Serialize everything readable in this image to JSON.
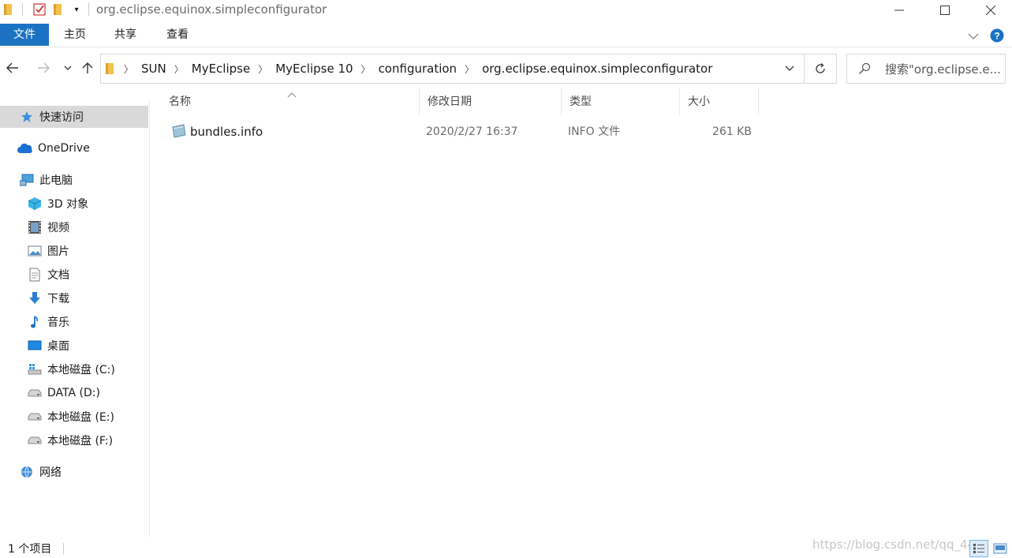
{
  "window": {
    "title": "org.eclipse.equinox.simpleconfigurator"
  },
  "ribbon": {
    "tabs": [
      {
        "label": "文件"
      },
      {
        "label": "主页"
      },
      {
        "label": "共享"
      },
      {
        "label": "查看"
      }
    ]
  },
  "address": {
    "crumbs": [
      "SUN",
      "MyEclipse",
      "MyEclipse 10",
      "configuration",
      "org.eclipse.equinox.simpleconfigurator"
    ]
  },
  "search": {
    "placeholder": "搜索\"org.eclipse.e..."
  },
  "sidebar": {
    "items": [
      {
        "label": "快速访问",
        "icon": "star-icon"
      },
      {
        "label": "OneDrive",
        "icon": "cloud-icon"
      },
      {
        "label": "此电脑",
        "icon": "computer-icon"
      },
      {
        "label": "3D 对象",
        "icon": "cube-icon"
      },
      {
        "label": "视频",
        "icon": "film-icon"
      },
      {
        "label": "图片",
        "icon": "picture-icon"
      },
      {
        "label": "文档",
        "icon": "document-icon"
      },
      {
        "label": "下载",
        "icon": "download-icon"
      },
      {
        "label": "音乐",
        "icon": "music-icon"
      },
      {
        "label": "桌面",
        "icon": "desktop-icon"
      },
      {
        "label": "本地磁盘 (C:)",
        "icon": "windows-drive-icon"
      },
      {
        "label": "DATA (D:)",
        "icon": "drive-icon"
      },
      {
        "label": "本地磁盘 (E:)",
        "icon": "drive-icon"
      },
      {
        "label": "本地磁盘 (F:)",
        "icon": "drive-icon"
      },
      {
        "label": "网络",
        "icon": "network-icon"
      }
    ]
  },
  "columns": {
    "name": "名称",
    "modified": "修改日期",
    "type": "类型",
    "size": "大小"
  },
  "files": [
    {
      "name": "bundles.info",
      "modified": "2020/2/27 16:37",
      "type": "INFO 文件",
      "size": "261 KB"
    }
  ],
  "status": {
    "count": "1 个项目"
  },
  "watermark": "https://blog.csdn.net/qq_44"
}
